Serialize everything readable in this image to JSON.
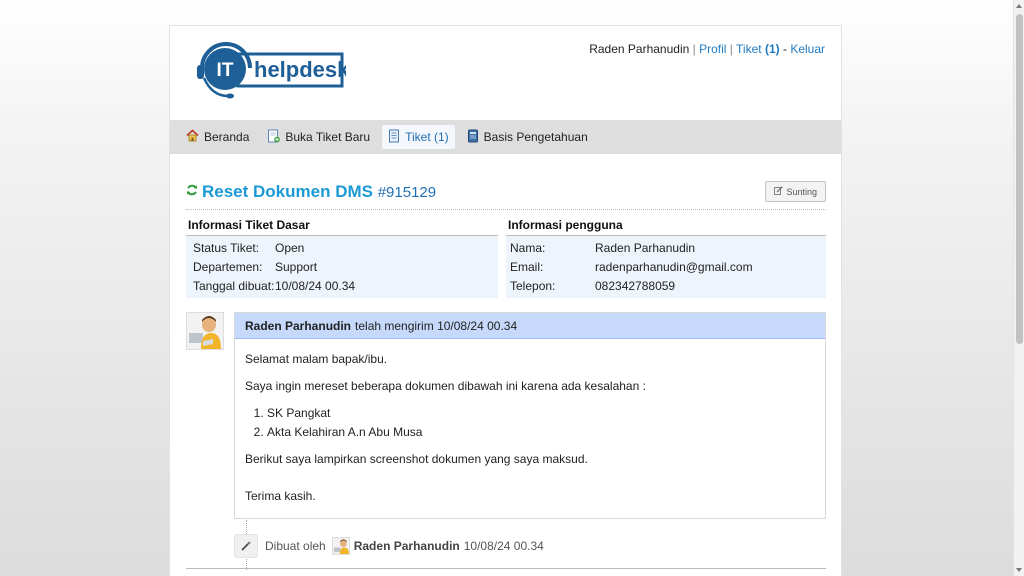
{
  "header": {
    "logo": {
      "prefix": "IT",
      "name": "helpdesk"
    },
    "user_name": "Raden Parhanudin",
    "separator": "|",
    "profile_link": "Profil",
    "tickets_link": "Tiket",
    "tickets_count": "(1)",
    "dash": "-",
    "logout_link": "Keluar"
  },
  "nav": {
    "items": [
      {
        "label": "Beranda",
        "icon": "home-icon"
      },
      {
        "label": "Buka Tiket Baru",
        "icon": "new-ticket-icon"
      },
      {
        "label": "Tiket (1)",
        "icon": "ticket-icon",
        "active": true
      },
      {
        "label": "Basis Pengetahuan",
        "icon": "book-icon"
      }
    ]
  },
  "ticket": {
    "title": "Reset Dokumen DMS",
    "number": "#915129",
    "edit_label": "Sunting",
    "basic_info_heading": "Informasi Tiket Dasar",
    "user_info_heading": "Informasi pengguna",
    "basic_info": [
      {
        "label": "Status Tiket:",
        "value": "Open"
      },
      {
        "label": "Departemen:",
        "value": "Support"
      },
      {
        "label": "Tanggal dibuat:",
        "value": "10/08/24 00.34"
      }
    ],
    "user_info": [
      {
        "label": "Nama:",
        "value": "Raden Parhanudin"
      },
      {
        "label": "Email:",
        "value": "radenparhanudin@gmail.com"
      },
      {
        "label": "Telepon:",
        "value": "082342788059"
      }
    ]
  },
  "thread": {
    "message": {
      "author": "Raden Parhanudin",
      "action": "telah mengirim",
      "timestamp": "10/08/24 00.34",
      "greeting": "Selamat malam bapak/ibu.",
      "intro": "Saya ingin mereset beberapa dokumen dibawah ini karena ada kesalahan :",
      "items": [
        "SK Pangkat",
        "Akta Kelahiran A.n Abu Musa"
      ],
      "closing_note": "Berikut saya lampirkan screenshot dokumen yang saya maksud.",
      "signoff": "Terima kasih."
    },
    "event": {
      "prefix": "Dibuat oleh",
      "author": "Raden Parhanudin",
      "timestamp": "10/08/24 00.34"
    }
  },
  "colors": {
    "link": "#1f7bc1",
    "title": "#1b9ad6",
    "logo_blue": "#1d5f96",
    "nav_bg": "#dedede",
    "message_header": "#c6d9fb",
    "info_bg": "#eef4fb"
  }
}
